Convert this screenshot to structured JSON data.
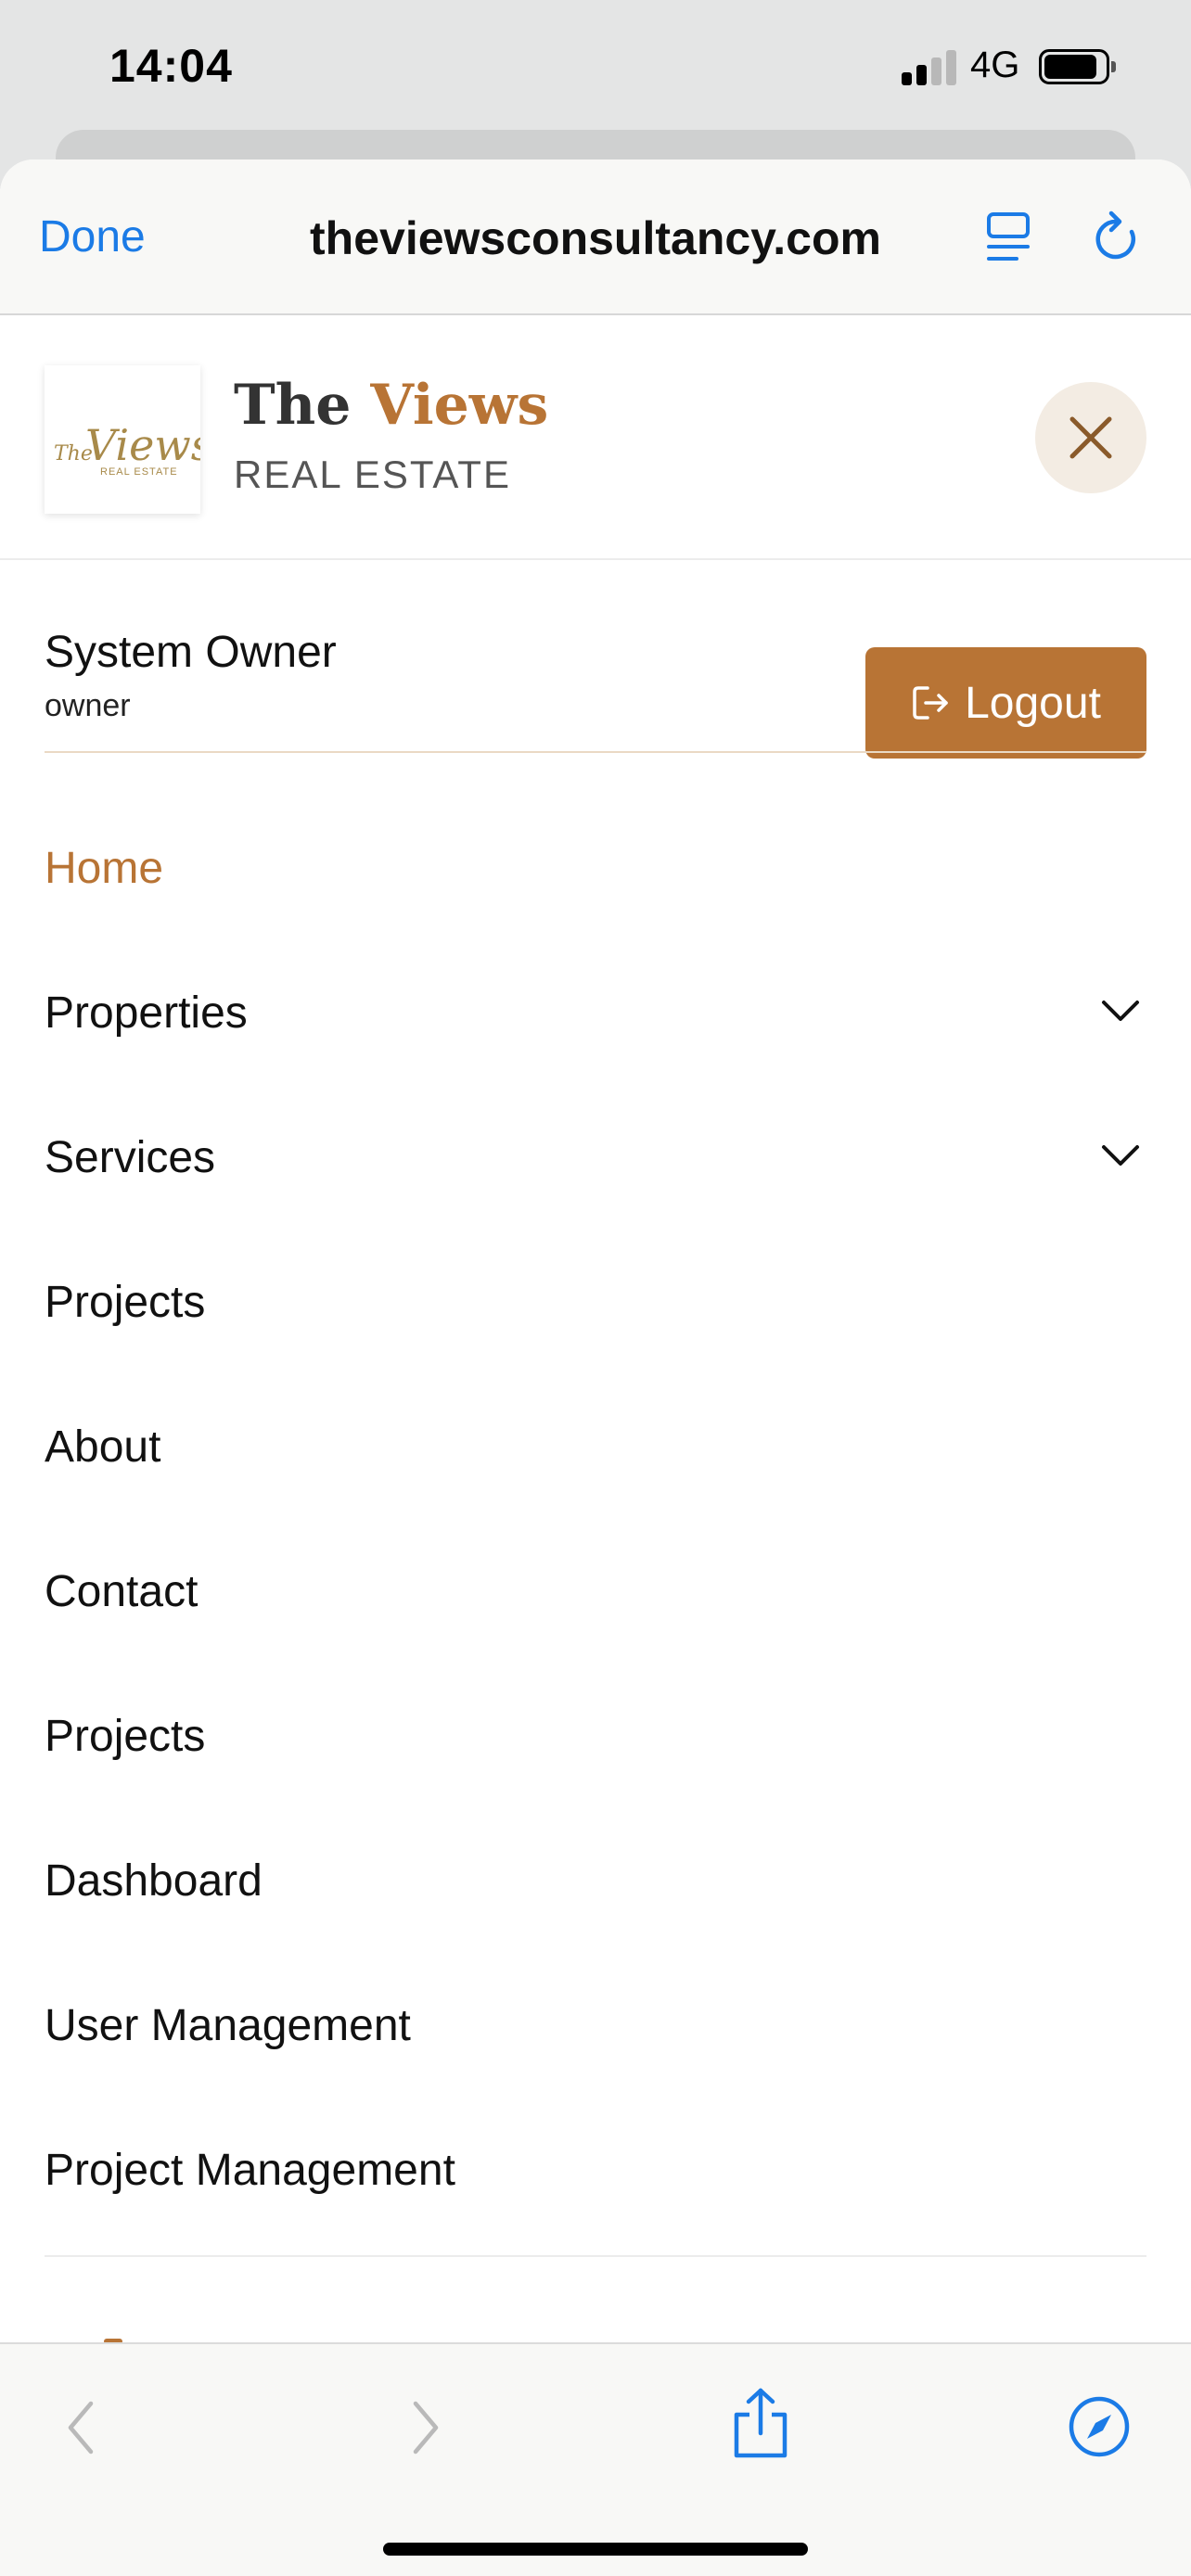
{
  "status_bar": {
    "time": "14:04",
    "network": "4G"
  },
  "browser": {
    "done_label": "Done",
    "url": "theviewsconsultancy.com"
  },
  "brand": {
    "title_part1": "The ",
    "title_part2": "Views",
    "subtitle": "REAL ESTATE",
    "logo_script": "The Views",
    "logo_sub": "REAL ESTATE",
    "accent_color": "#b87435"
  },
  "user": {
    "name": "System Owner",
    "role": "owner",
    "logout_label": "Logout"
  },
  "nav": {
    "items": [
      {
        "label": "Home",
        "active": true,
        "has_dropdown": false
      },
      {
        "label": "Properties",
        "active": false,
        "has_dropdown": true
      },
      {
        "label": "Services",
        "active": false,
        "has_dropdown": true
      },
      {
        "label": "Projects",
        "active": false,
        "has_dropdown": false
      },
      {
        "label": "About",
        "active": false,
        "has_dropdown": false
      },
      {
        "label": "Contact",
        "active": false,
        "has_dropdown": false
      },
      {
        "label": "Projects",
        "active": false,
        "has_dropdown": false
      },
      {
        "label": "Dashboard",
        "active": false,
        "has_dropdown": false
      },
      {
        "label": "User Management",
        "active": false,
        "has_dropdown": false
      },
      {
        "label": "Project Management",
        "active": false,
        "has_dropdown": false
      }
    ]
  },
  "toolbar": {
    "icons": [
      "back-icon",
      "forward-icon",
      "share-icon",
      "compass-icon"
    ]
  }
}
